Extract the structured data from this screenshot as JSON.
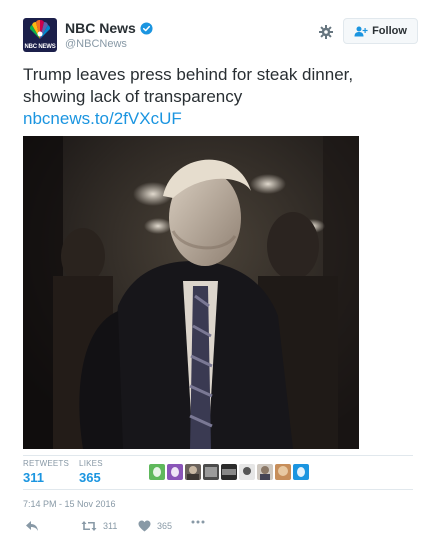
{
  "account": {
    "display_name": "NBC News",
    "handle": "@NBCNews",
    "avatar_text": "NBC NEWS",
    "verified": true
  },
  "follow": {
    "label": "Follow"
  },
  "tweet": {
    "text": "Trump leaves press behind for steak dinner, showing lack of transparency",
    "link": "nbcnews.to/2fVXcUF",
    "timestamp": "7:14 PM - 15 Nov 2016"
  },
  "stats": {
    "retweets_label": "RETWEETS",
    "retweets_value": "311",
    "likes_label": "LIKES",
    "likes_value": "365"
  },
  "actions": {
    "reply_icon": "reply-icon",
    "retweet_icon": "retweet-icon",
    "retweet_count": "311",
    "like_icon": "heart-icon",
    "like_count": "365",
    "more_icon": "more-icon"
  },
  "colors": {
    "link": "#1b95e0",
    "muted": "#8899a6",
    "text": "#292f33",
    "border": "#e1e8ed"
  }
}
